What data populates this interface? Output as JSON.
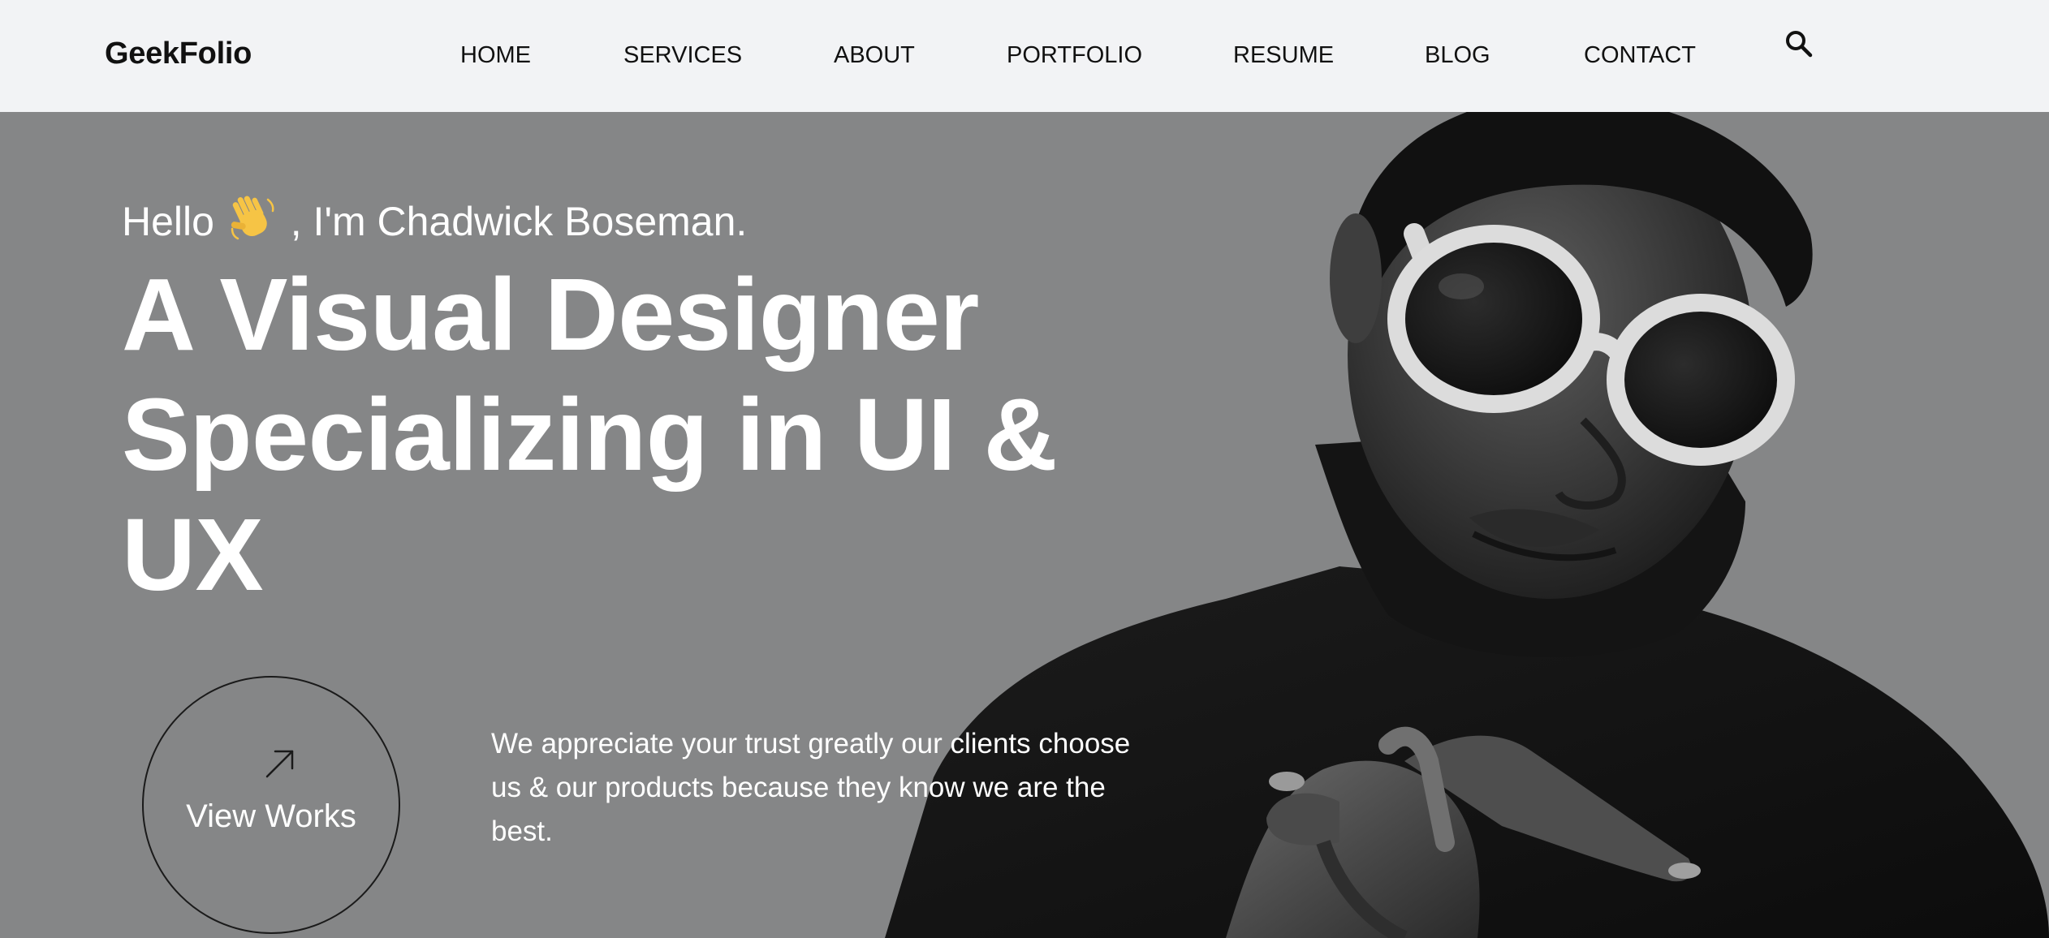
{
  "header": {
    "logo": "GeekFolio",
    "nav": {
      "home": "HOME",
      "services": "SERVICES",
      "about": "ABOUT",
      "portfolio": "PORTFOLIO",
      "resume": "RESUME",
      "blog": "BLOG",
      "contact": "CONTACT"
    },
    "search_icon": "search-icon"
  },
  "hero": {
    "greeting_prefix": "Hello",
    "greeting_icon": "waving-hand-icon",
    "greeting_suffix": ", I'm Chadwick Boseman.",
    "headline": "A Visual Designer Specializing in UI & UX",
    "cta_label": "View Works",
    "cta_icon": "arrow-up-right-icon",
    "tagline": "We appreciate your trust greatly our clients choose us & our products because they know we are the best.",
    "image": "portrait-photo"
  },
  "colors": {
    "header_bg": "#f2f3f5",
    "hero_bg": "#858687",
    "text_light": "#ffffff",
    "text_dark": "#111111"
  }
}
